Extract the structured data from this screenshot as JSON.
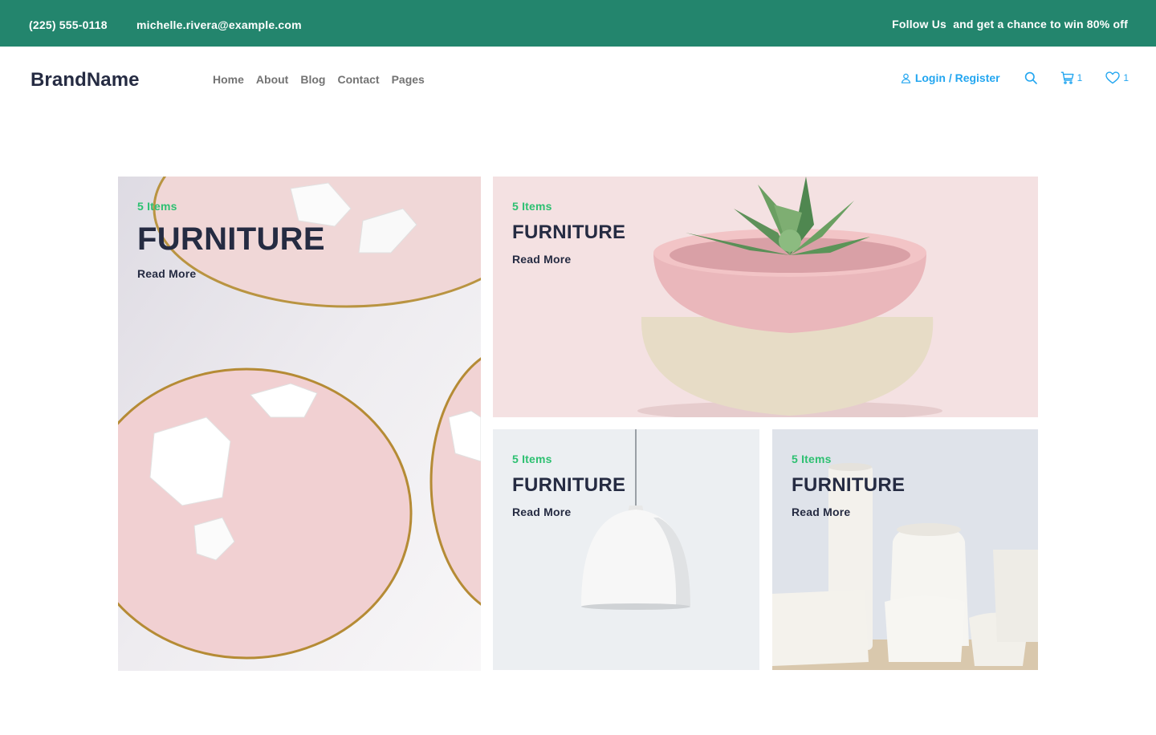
{
  "topbar": {
    "phone": "(225) 555-0118",
    "email": "michelle.rivera@example.com",
    "promo": "Follow Us  and get a chance to win 80% off"
  },
  "header": {
    "brand": "BrandName",
    "nav": [
      "Home",
      "About",
      "Blog",
      "Contact",
      "Pages"
    ],
    "login_label": "Login / Register",
    "cart_count": "1",
    "wishlist_count": "1"
  },
  "icons": {
    "user": "user-icon",
    "search": "search-icon",
    "cart": "cart-icon",
    "wishlist": "heart-icon"
  },
  "colors": {
    "topbar_bg": "#23856d",
    "accent": "#23a6f0",
    "success": "#2dc071",
    "heading": "#252b42",
    "nav_text": "#737373"
  },
  "cards": [
    {
      "items": "5 Items",
      "title": "FURNITURE",
      "link": "Read More",
      "image": "pink plates with coconut pieces"
    },
    {
      "items": "5 Items",
      "title": "FURNITURE",
      "link": "Read More",
      "image": "succulent in ceramic bowl"
    },
    {
      "items": "5 Items",
      "title": "FURNITURE",
      "link": "Read More",
      "image": "white pendant lamp"
    },
    {
      "items": "5 Items",
      "title": "FURNITURE",
      "link": "Read More",
      "image": "white ceramic vases"
    }
  ]
}
